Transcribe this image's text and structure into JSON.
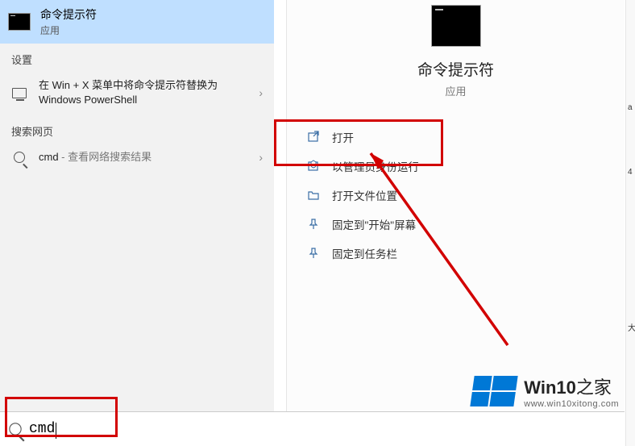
{
  "best_match": {
    "title": "命令提示符",
    "subtitle": "应用"
  },
  "sections": {
    "settings_header": "设置",
    "settings_item": "在 Win + X 菜单中将命令提示符替换为 Windows PowerShell",
    "web_header": "搜索网页",
    "web_item_prefix": "cmd",
    "web_item_suffix": " - 查看网络搜索结果"
  },
  "app_detail": {
    "title": "命令提示符",
    "subtitle": "应用",
    "actions": [
      "打开",
      "以管理员身份运行",
      "打开文件位置",
      "固定到\"开始\"屏幕",
      "固定到任务栏"
    ]
  },
  "search": {
    "query": "cmd"
  },
  "watermark": {
    "brand": "Win10",
    "suffix": "之家",
    "url": "www.win10xitong.com"
  },
  "side_glyphs": {
    "a": "a",
    "b": "4",
    "c": "大"
  },
  "colors": {
    "selected_bg": "#BFDFFF",
    "highlight": "#d20000",
    "win_blue": "#0078d6"
  }
}
